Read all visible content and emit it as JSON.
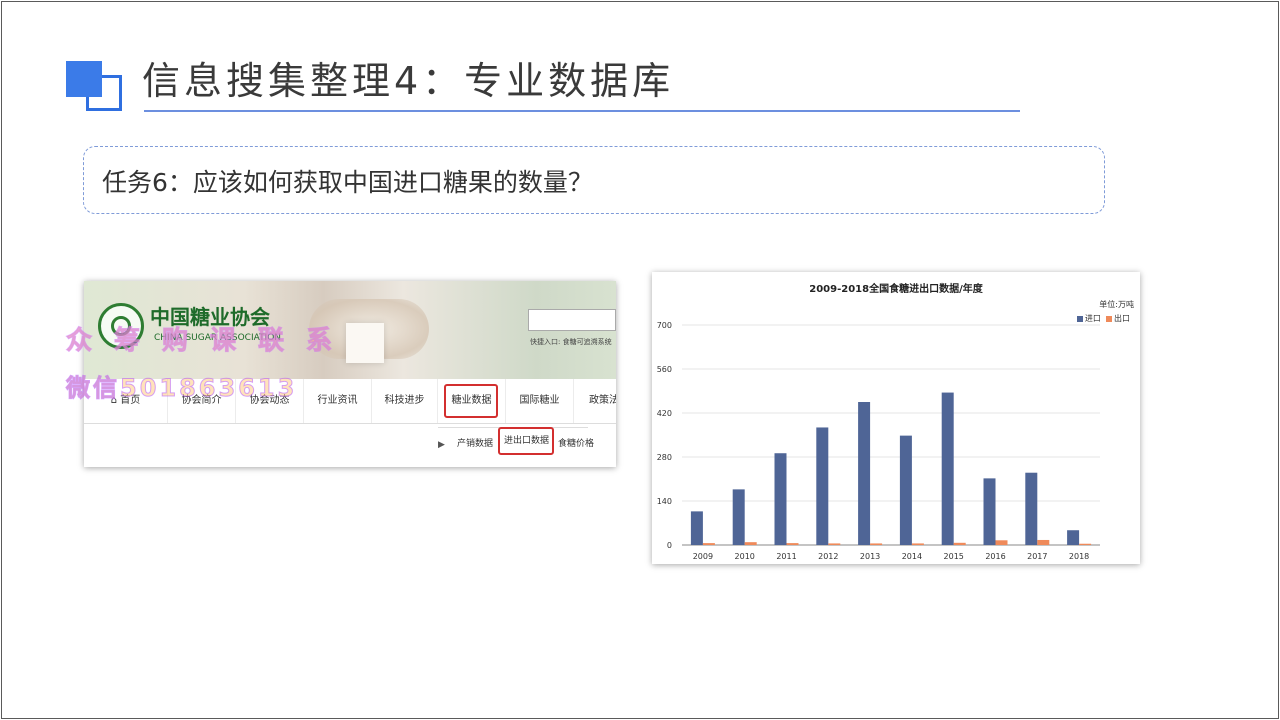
{
  "slide": {
    "title": "信息搜集整理4：专业数据库",
    "task": "任务6：应该如何获取中国进口糖果的数量？"
  },
  "website": {
    "org_name_cn": "中国糖业协会",
    "org_name_en": "CHINA SUGAR ASSOCIATION",
    "quick_links": "快捷入口:  食糖可追溯系统",
    "nav": [
      {
        "label": "⌂ 首页"
      },
      {
        "label": "协会简介"
      },
      {
        "label": "协会动态"
      },
      {
        "label": "行业资讯"
      },
      {
        "label": "科技进步"
      },
      {
        "label": "糖业数据",
        "highlighted": true
      },
      {
        "label": "国际糖业"
      },
      {
        "label": "政策法"
      }
    ],
    "submenu": [
      {
        "label": "产销数据"
      },
      {
        "label": "进出口数据",
        "highlighted": true
      },
      {
        "label": "食糖价格"
      }
    ],
    "highlight_color": "#d32f2f"
  },
  "watermark": {
    "line1": "众筹购课联系",
    "line2": "微信501863613"
  },
  "chart_data": {
    "type": "bar",
    "title": "2009-2018全国食糖进出口数据/年度",
    "unit": "单位:万吨",
    "categories": [
      "2009",
      "2010",
      "2011",
      "2012",
      "2013",
      "2014",
      "2015",
      "2016",
      "2017",
      "2018"
    ],
    "series": [
      {
        "name": "进口",
        "color": "#4f6596",
        "values": [
          107,
          177,
          292,
          374,
          455,
          348,
          485,
          212,
          230,
          47
        ]
      },
      {
        "name": "出口",
        "color": "#ef8a5a",
        "values": [
          6,
          9,
          6,
          5,
          5,
          5,
          7,
          15,
          16,
          4
        ]
      }
    ],
    "ylim": [
      0,
      700
    ],
    "yticks": [
      0,
      140,
      280,
      420,
      560,
      700
    ],
    "grid": true,
    "legend": "top-right"
  }
}
